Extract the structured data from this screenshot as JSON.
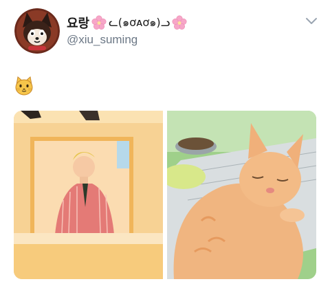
{
  "tweet": {
    "author": {
      "name": "요랑",
      "name_kaomoji": "ᓚ(๑ơᴀơ๑)ᓗ",
      "handle": "@xiu_suming",
      "avatar_icon": "cartoon-cat-avatar"
    },
    "menu_icon": "chevron-down-icon",
    "text_emoji": "🐱",
    "media": [
      {
        "alt_icon": "person-photo"
      },
      {
        "alt_icon": "sleeping-cat-photo"
      }
    ]
  },
  "colors": {
    "name_text": "#1a1a1a",
    "handle_text": "#6b7785",
    "flower": "#f7a6c8"
  }
}
